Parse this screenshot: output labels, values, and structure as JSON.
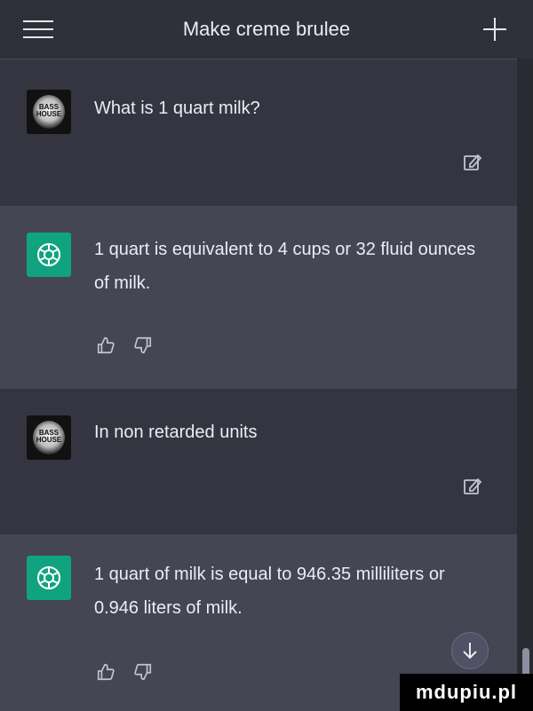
{
  "header": {
    "title": "Make creme brulee"
  },
  "avatar": {
    "user_text_line1": "BASS",
    "user_text_line2": "HOUSE"
  },
  "messages": [
    {
      "role": "user",
      "text": "What is 1 quart milk?"
    },
    {
      "role": "assistant",
      "text": "1 quart is equivalent to 4 cups or 32 fluid ounces of milk."
    },
    {
      "role": "user",
      "text": "In non retarded units"
    },
    {
      "role": "assistant",
      "text": "1 quart of milk is equal to 946.35 milliliters or 0.946 liters of milk."
    }
  ],
  "watermark": "mdupiu.pl",
  "colors": {
    "background": "#343541",
    "assistant_row": "#444654",
    "bot_avatar": "#10a37f",
    "text": "#ececf1"
  }
}
